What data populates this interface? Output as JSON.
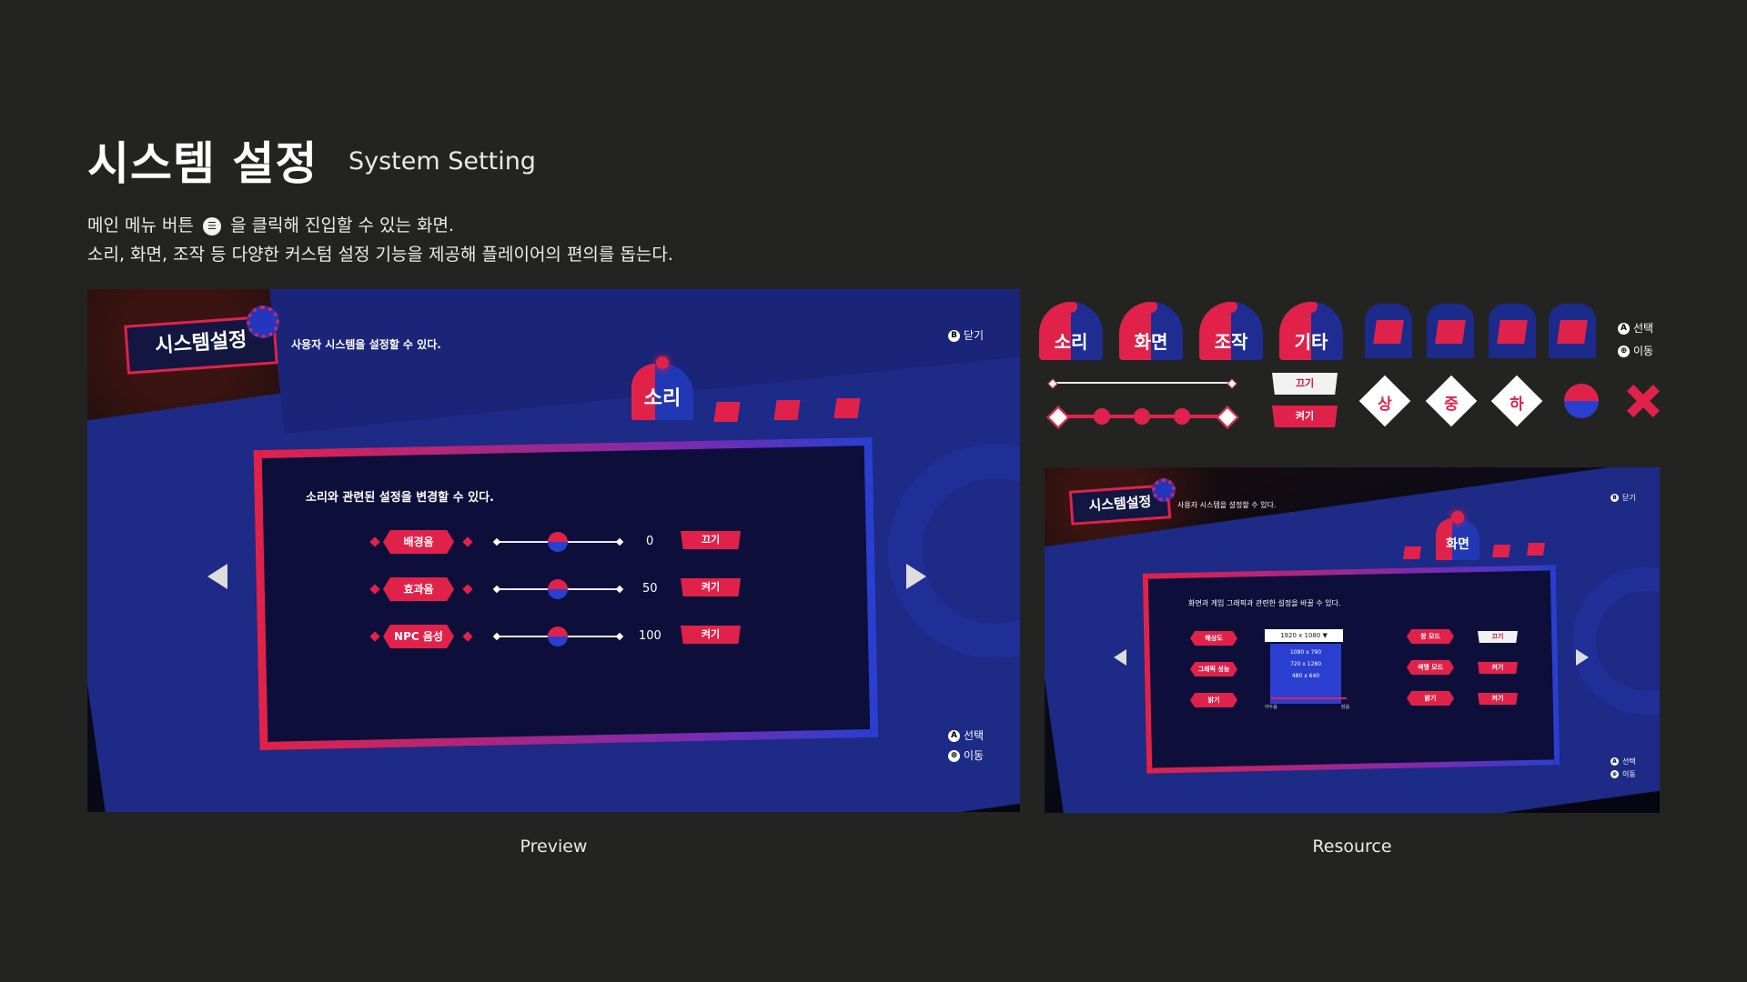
{
  "header": {
    "title_ko": "시스템 설정",
    "title_en": "System Setting",
    "desc_line1_a": "메인 메뉴 버튼",
    "desc_line1_icon": "menu-button-icon",
    "desc_line1_b": "을 클릭해 진입할 수 있는 화면.",
    "desc_line2": "소리, 화면, 조작 등 다양한 커스텀 설정 기능을 제공해 플레이어의 편의를 돕는다."
  },
  "preview": {
    "logo": "시스템설정",
    "subtitle": "사용자 시스템을 설정할 수 있다.",
    "close_hint": "닫기",
    "close_key": "B",
    "active_tab": "소리",
    "card_desc": "소리와 관련된 설정을 변경할 수 있다.",
    "rows": [
      {
        "label": "배경음",
        "value": "0",
        "toggle": "끄기",
        "level": 0.5
      },
      {
        "label": "효과음",
        "value": "50",
        "toggle": "켜기",
        "level": 0.5
      },
      {
        "label": "NPC 음성",
        "value": "100",
        "toggle": "켜기",
        "level": 0.5
      }
    ],
    "select_hint": "선택",
    "select_key": "A",
    "move_hint": "이동",
    "move_key": "⊕",
    "caption": "Preview"
  },
  "resource": {
    "tabs": [
      "소리",
      "화면",
      "조작",
      "기타"
    ],
    "icon_tabs": [
      "sound-tab-icon",
      "screen-tab-icon",
      "control-tab-icon",
      "etc-tab-icon"
    ],
    "hint_select": "선택",
    "hint_move": "이동",
    "toggle_off": "끄기",
    "toggle_on": "켜기",
    "quality": [
      "상",
      "중",
      "하"
    ]
  },
  "resource_preview": {
    "logo": "시스템설정",
    "subtitle": "사용자 시스템을 설정할 수 있다.",
    "close_hint": "닫기",
    "active_tab": "화면",
    "card_desc": "화면과 게임 그래픽과 관련한 설정을 바꿀 수 있다.",
    "left_rows": [
      "해상도",
      "그래픽 성능",
      "밝기"
    ],
    "resolutions": [
      "1920 x 1080",
      "1080 x 790",
      "720 x 1280",
      "480 x 640"
    ],
    "slider_min": "어두움",
    "slider_max": "밝음",
    "right_rows": [
      {
        "label": "창 모드",
        "toggle": "끄기"
      },
      {
        "label": "색맹 모드",
        "toggle": "켜기"
      },
      {
        "label": "밝기",
        "toggle": "켜기"
      }
    ],
    "select_hint": "선택",
    "move_hint": "이동",
    "caption": "Resource"
  },
  "colors": {
    "accent": "#e0224a",
    "blue": "#2a3fd0",
    "bg": "#232422"
  }
}
